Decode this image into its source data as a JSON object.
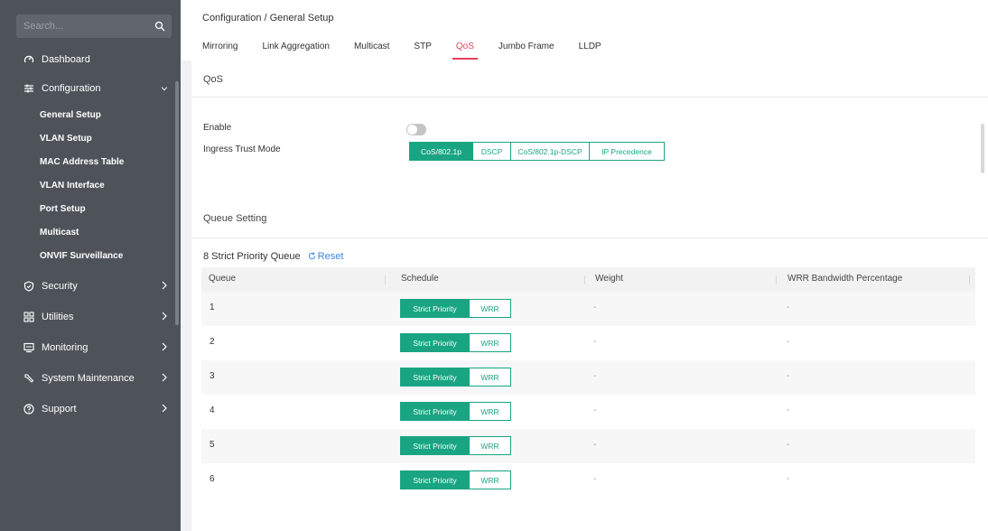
{
  "sidebar": {
    "search_placeholder": "Search...",
    "items": [
      {
        "label": "Dashboard",
        "icon": "dashboard-icon"
      },
      {
        "label": "Configuration",
        "icon": "sliders-icon",
        "expanded": true,
        "subitems": [
          "General Setup",
          "VLAN Setup",
          "MAC Address Table",
          "VLAN Interface",
          "Port Setup",
          "Multicast",
          "ONVIF Surveillance"
        ]
      },
      {
        "label": "Security",
        "icon": "shield-icon"
      },
      {
        "label": "Utilities",
        "icon": "grid-icon"
      },
      {
        "label": "Monitoring",
        "icon": "monitor-icon"
      },
      {
        "label": "System Maintenance",
        "icon": "wrench-icon"
      },
      {
        "label": "Support",
        "icon": "help-icon"
      }
    ]
  },
  "header": {
    "breadcrumb": "Configuration / General Setup",
    "tabs": [
      "Mirroring",
      "Link Aggregation",
      "Multicast",
      "STP",
      "QoS",
      "Jumbo Frame",
      "LLDP"
    ],
    "active_tab": "QoS"
  },
  "qos": {
    "title": "QoS",
    "enable_label": "Enable",
    "enabled": false,
    "trust_mode_label": "Ingress Trust Mode",
    "trust_modes": [
      "CoS/802.1p",
      "DSCP",
      "CoS/802.1p-DSCP",
      "IP Precedence"
    ],
    "trust_mode_selected": "CoS/802.1p"
  },
  "queue_setting": {
    "title": "Queue Setting",
    "mode_text": "8 Strict Priority Queue",
    "reset_label": "Reset",
    "columns": [
      "Queue",
      "Schedule",
      "Weight",
      "WRR Bandwidth Percentage"
    ],
    "schedule_options": [
      "Strict Priority",
      "WRR"
    ],
    "rows": [
      {
        "queue": "1",
        "schedule": "Strict Priority",
        "weight": "-",
        "wrr_bw": "-"
      },
      {
        "queue": "2",
        "schedule": "Strict Priority",
        "weight": "-",
        "wrr_bw": "-"
      },
      {
        "queue": "3",
        "schedule": "Strict Priority",
        "weight": "-",
        "wrr_bw": "-"
      },
      {
        "queue": "4",
        "schedule": "Strict Priority",
        "weight": "-",
        "wrr_bw": "-"
      },
      {
        "queue": "5",
        "schedule": "Strict Priority",
        "weight": "-",
        "wrr_bw": "-"
      },
      {
        "queue": "6",
        "schedule": "Strict Priority",
        "weight": "-",
        "wrr_bw": "-"
      }
    ]
  },
  "colors": {
    "accent": "#1aa582",
    "tab_active": "#e5405e",
    "link": "#3c86e0",
    "sidebar_bg": "#4d5359"
  }
}
